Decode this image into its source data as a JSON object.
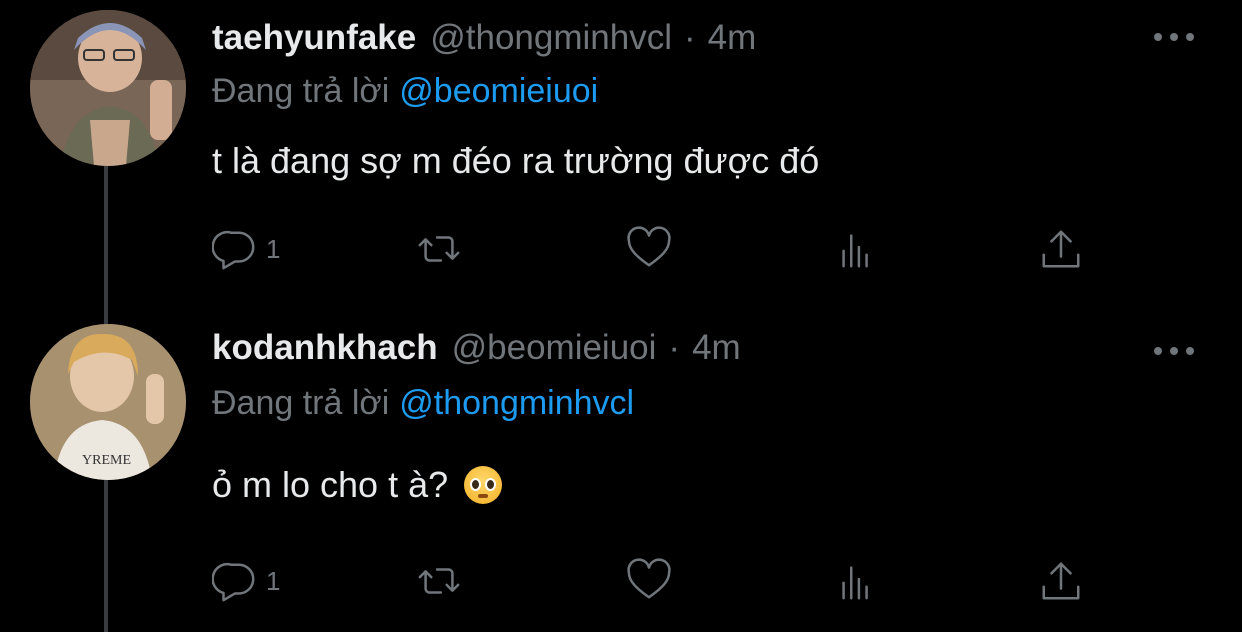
{
  "tweets": [
    {
      "display_name": "taehyunfake",
      "handle": "@thongminhvcl",
      "separator": "·",
      "time": "4m",
      "reply_prefix": "Đang trả lời",
      "reply_to": "@beomieiuoi",
      "text": "t là đang sợ m đéo ra trường được đó",
      "emoji": "",
      "reply_count": "1"
    },
    {
      "display_name": "kodanhkhach",
      "handle": "@beomieiuoi",
      "separator": "·",
      "time": "4m",
      "reply_prefix": "Đang trả lời",
      "reply_to": "@thongminhvcl",
      "text": "ỏ m lo cho t à?",
      "emoji": "pleading-face",
      "reply_count": "1"
    }
  ],
  "icons": {
    "reply": "reply-icon",
    "retweet": "retweet-icon",
    "like": "heart-icon",
    "views": "views-icon",
    "share": "share-icon",
    "more": "more-icon"
  },
  "colors": {
    "background": "#000000",
    "text": "#e7e9ea",
    "muted": "#71767b",
    "link": "#1d9bf0",
    "thread_line": "#3a3d40"
  }
}
